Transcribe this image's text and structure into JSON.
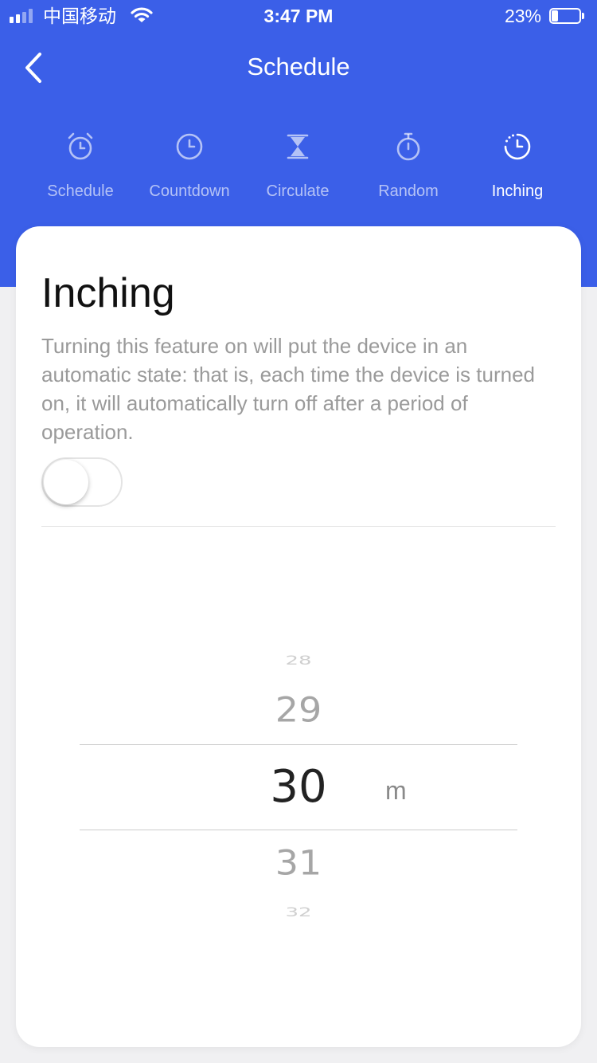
{
  "status_bar": {
    "carrier": "中国移动",
    "time": "3:47 PM",
    "battery_percent": "23%",
    "battery_level": 0.23,
    "signal_bars_active": 2,
    "signal_bars_total": 4
  },
  "nav": {
    "back_icon": "chevron-left-icon",
    "title": "Schedule"
  },
  "tabs": [
    {
      "label": "Schedule",
      "icon": "alarm-clock-icon",
      "active": false
    },
    {
      "label": "Countdown",
      "icon": "clock-icon",
      "active": false
    },
    {
      "label": "Circulate",
      "icon": "hourglass-icon",
      "active": false
    },
    {
      "label": "Random",
      "icon": "stopwatch-icon",
      "active": false
    },
    {
      "label": "Inching",
      "icon": "timer-icon",
      "active": true
    }
  ],
  "card": {
    "title": "Inching",
    "description": "Turning this feature on will put the device in an automatic state: that is, each time the device is turned on, it will automatically turn off after a period of operation.",
    "toggle_on": false
  },
  "picker": {
    "values": [
      "28",
      "29",
      "30",
      "31",
      "32"
    ],
    "selected": "30",
    "unit": "m"
  },
  "colors": {
    "primary": "#3b5fe8",
    "background": "#f0f0f2",
    "card": "#ffffff"
  }
}
